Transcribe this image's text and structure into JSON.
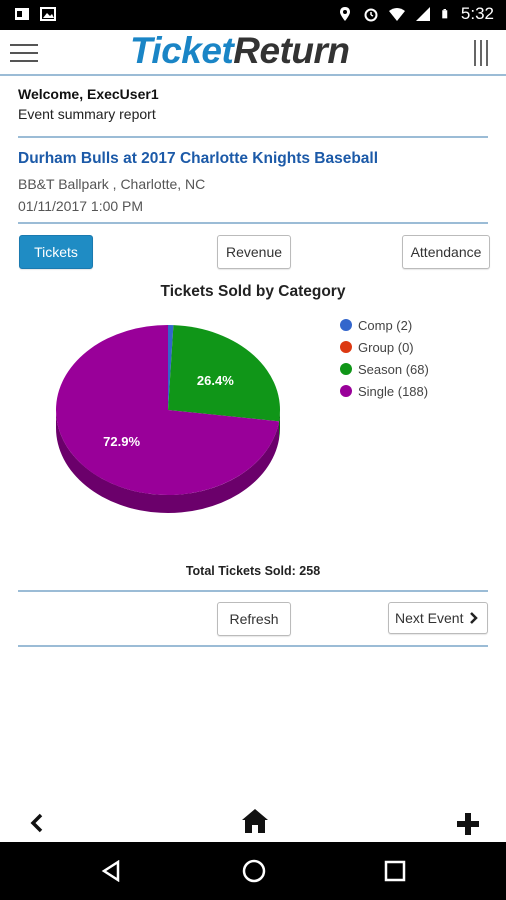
{
  "status_bar": {
    "time": "5:32"
  },
  "app": {
    "logo_part1": "Ticket",
    "logo_part2": "Return"
  },
  "welcome": {
    "greeting": "Welcome, ExecUser1",
    "subtitle": "Event summary report"
  },
  "event": {
    "title": "Durham Bulls at 2017 Charlotte Knights Baseball",
    "venue": "BB&T Ballpark , Charlotte, NC",
    "datetime": "01/11/2017 1:00 PM"
  },
  "tabs": {
    "tickets": "Tickets",
    "revenue": "Revenue",
    "attendance": "Attendance"
  },
  "chart_data": {
    "type": "pie",
    "title": "Tickets Sold by Category",
    "categories": [
      "Comp (2)",
      "Group (0)",
      "Season (68)",
      "Single (188)"
    ],
    "values": [
      2,
      0,
      68,
      188
    ],
    "colors": [
      "#3366cc",
      "#dc3912",
      "#109618",
      "#990099"
    ],
    "data_labels": [
      "",
      "",
      "26.4%",
      "72.9%"
    ],
    "legend_position": "right"
  },
  "total": "Total Tickets Sold: 258",
  "actions": {
    "refresh": "Refresh",
    "next_event": "Next Event"
  },
  "icons": {
    "back": "chevron-left-icon",
    "home": "home-icon",
    "add": "plus-icon"
  }
}
